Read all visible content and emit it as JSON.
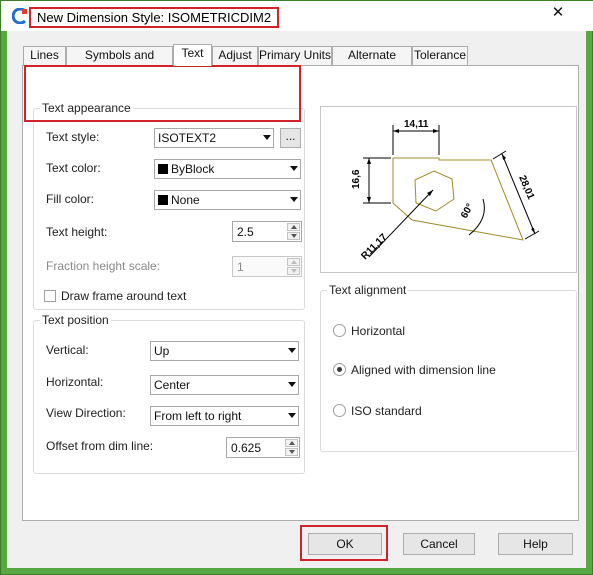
{
  "window": {
    "title": "New Dimension Style: ISOMETRICDIM2",
    "close_glyph": "✕",
    "app_icon": "app-logo-icon"
  },
  "tabs": [
    {
      "label": "Lines",
      "active": false
    },
    {
      "label": "Symbols and Arrows",
      "active": false
    },
    {
      "label": "Text",
      "active": true
    },
    {
      "label": "Adjust",
      "active": false
    },
    {
      "label": "Primary Units",
      "active": false
    },
    {
      "label": "Alternate Units",
      "active": false
    },
    {
      "label": "Tolerance",
      "active": false
    }
  ],
  "text_appearance": {
    "legend": "Text appearance",
    "text_style": {
      "label": "Text style:",
      "value": "ISOTEXT2",
      "browse_label": "..."
    },
    "text_color": {
      "label": "Text color:",
      "value": "ByBlock",
      "swatch": "#000000"
    },
    "fill_color": {
      "label": "Fill color:",
      "value": "None",
      "swatch": "#000000"
    },
    "text_height": {
      "label": "Text height:",
      "value": "2.5"
    },
    "fraction_height_scale": {
      "label": "Fraction height scale:",
      "value": "1",
      "enabled": false
    },
    "draw_frame": {
      "label": "Draw frame around text",
      "checked": false
    }
  },
  "text_position": {
    "legend": "Text position",
    "vertical": {
      "label": "Vertical:",
      "value": "Up"
    },
    "horizontal": {
      "label": "Horizontal:",
      "value": "Center"
    },
    "view_direction": {
      "label": "View Direction:",
      "value": "From left to right"
    },
    "offset": {
      "label": "Offset from dim line:",
      "value": "0.625"
    }
  },
  "text_alignment": {
    "legend": "Text alignment",
    "options": [
      {
        "label": "Horizontal",
        "checked": false
      },
      {
        "label": "Aligned with dimension line",
        "checked": true
      },
      {
        "label": "ISO standard",
        "checked": false
      }
    ]
  },
  "preview": {
    "dims": {
      "top": "14,11",
      "left": "16,6",
      "right": "28,01",
      "angle": "60°",
      "radius": "R11,17"
    },
    "line_color": "#a08c2c"
  },
  "buttons": {
    "ok": "OK",
    "cancel": "Cancel",
    "help": "Help"
  },
  "colors": {
    "highlight": "#d1232a",
    "frame": "#5aa844"
  }
}
